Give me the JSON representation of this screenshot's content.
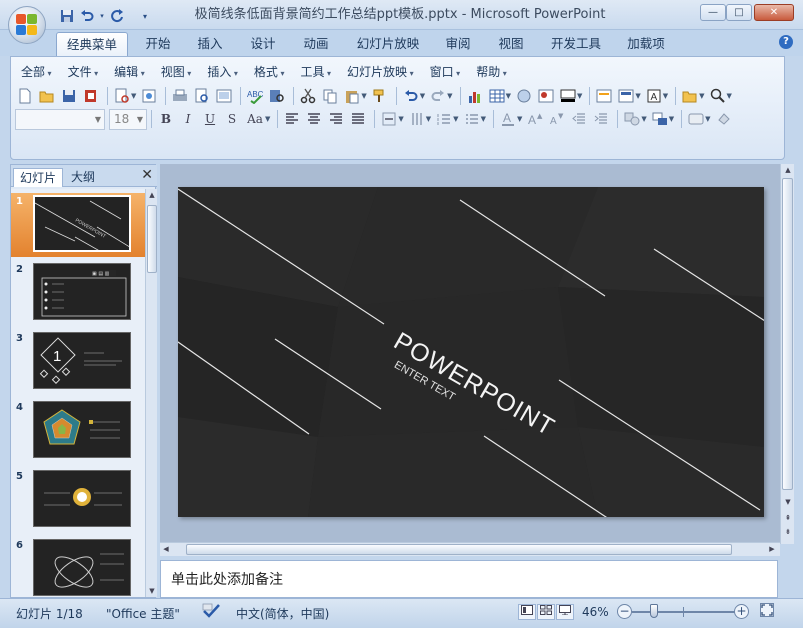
{
  "window": {
    "title": "极简线条低面背景简约工作总结ppt模板.pptx - Microsoft PowerPoint",
    "minimize": "—",
    "maximize": "□",
    "close": "✕"
  },
  "qat": {
    "save_icon": "save-icon",
    "undo_icon": "undo-icon",
    "redo_icon": "redo-icon",
    "customize_icon": "chevron-down-icon"
  },
  "tabs": [
    {
      "label": "经典菜单",
      "active": true
    },
    {
      "label": "开始"
    },
    {
      "label": "插入"
    },
    {
      "label": "设计"
    },
    {
      "label": "动画"
    },
    {
      "label": "幻灯片放映"
    },
    {
      "label": "审阅"
    },
    {
      "label": "视图"
    },
    {
      "label": "开发工具"
    },
    {
      "label": "加载项"
    }
  ],
  "menus": [
    "全部",
    "文件",
    "编辑",
    "视图",
    "插入",
    "格式",
    "工具",
    "幻灯片放映",
    "窗口",
    "帮助"
  ],
  "font": {
    "name_value": "",
    "size_value": "18"
  },
  "format_buttons": {
    "bold": "B",
    "italic": "I",
    "underline": "U",
    "strike": "S",
    "case": "Aa"
  },
  "panel": {
    "tab_slides": "幻灯片",
    "tab_outline": "大纲",
    "close": "✕"
  },
  "thumbs": [
    {
      "num": "1"
    },
    {
      "num": "2"
    },
    {
      "num": "3"
    },
    {
      "num": "4"
    },
    {
      "num": "5"
    },
    {
      "num": "6"
    }
  ],
  "thumb3_digit": "1",
  "slide": {
    "title": "POWERPOINT",
    "subtitle": "ENTER TEXT"
  },
  "notes": {
    "placeholder": "单击此处添加备注"
  },
  "status": {
    "slide_count": "幻灯片 1/18",
    "theme": "\"Office 主题\"",
    "language": "中文(简体，中国)",
    "zoom": "46%"
  },
  "zoom_fraction": 0.46,
  "colors": {
    "accent": "#e3822e",
    "slide_bg": "#262626",
    "ribbon": "#dae6f5"
  }
}
